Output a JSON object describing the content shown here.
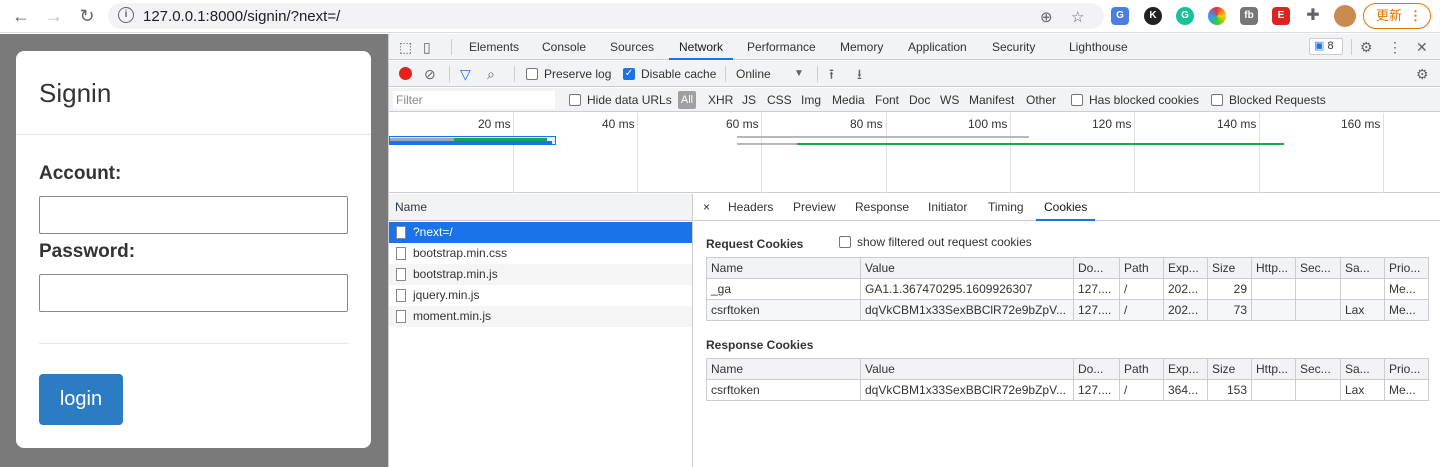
{
  "browser": {
    "url": "127.0.0.1:8000/signin/?next=/",
    "update_label": "更新",
    "update_dots": "⋮",
    "icons": [
      "back-icon",
      "forward-icon",
      "reload-icon",
      "info-icon",
      "zoom-icon",
      "star-icon",
      "translate-icon",
      "extensions-icon",
      "avatar"
    ]
  },
  "page": {
    "title": "Signin",
    "account_label": "Account:",
    "account_value": "",
    "password_label": "Password:",
    "password_value": "",
    "login_label": "login",
    "accent": "#2c7cc3"
  },
  "devtools": {
    "tabs": [
      "Elements",
      "Console",
      "Sources",
      "Network",
      "Performance",
      "Memory",
      "Application",
      "Security",
      "Lighthouse"
    ],
    "active_tab": "Network",
    "issues_count": "8",
    "toolbar": {
      "preserve_log": "Preserve log",
      "disable_cache": "Disable cache",
      "throttle": "Online"
    },
    "filter": {
      "placeholder": "Filter",
      "hide_data_urls": "Hide data URLs",
      "all": "All",
      "types": [
        "XHR",
        "JS",
        "CSS",
        "Img",
        "Media",
        "Font",
        "Doc",
        "WS",
        "Manifest",
        "Other"
      ],
      "has_blocked_cookies": "Has blocked cookies",
      "blocked_requests": "Blocked Requests"
    },
    "timeline_ticks": [
      "20 ms",
      "40 ms",
      "60 ms",
      "80 ms",
      "100 ms",
      "120 ms",
      "140 ms",
      "160 ms"
    ],
    "requests_header": "Name",
    "requests": [
      "?next=/",
      "bootstrap.min.css",
      "bootstrap.min.js",
      "jquery.min.js",
      "moment.min.js"
    ],
    "detail_tabs": [
      "×",
      "Headers",
      "Preview",
      "Response",
      "Initiator",
      "Timing",
      "Cookies"
    ],
    "active_detail_tab": "Cookies",
    "request_cookies_title": "Request Cookies",
    "show_filtered_label": "show filtered out request cookies",
    "cookie_columns": [
      "Name",
      "Value",
      "Do...",
      "Path",
      "Exp...",
      "Size",
      "Http...",
      "Sec...",
      "Sa...",
      "Prio..."
    ],
    "request_cookies": [
      [
        "_ga",
        "GA1.1.367470295.1609926307",
        "127....",
        "/",
        "202...",
        "29",
        "",
        "",
        "",
        "Me..."
      ],
      [
        "csrftoken",
        "dqVkCBM1x33SexBBClR72e9bZpV...",
        "127....",
        "/",
        "202...",
        "73",
        "",
        "",
        "Lax",
        "Me..."
      ]
    ],
    "response_cookies_title": "Response Cookies",
    "response_cookies": [
      [
        "csrftoken",
        "dqVkCBM1x33SexBBClR72e9bZpV...",
        "127....",
        "/",
        "364...",
        "153",
        "",
        "",
        "Lax",
        "Me..."
      ]
    ]
  }
}
